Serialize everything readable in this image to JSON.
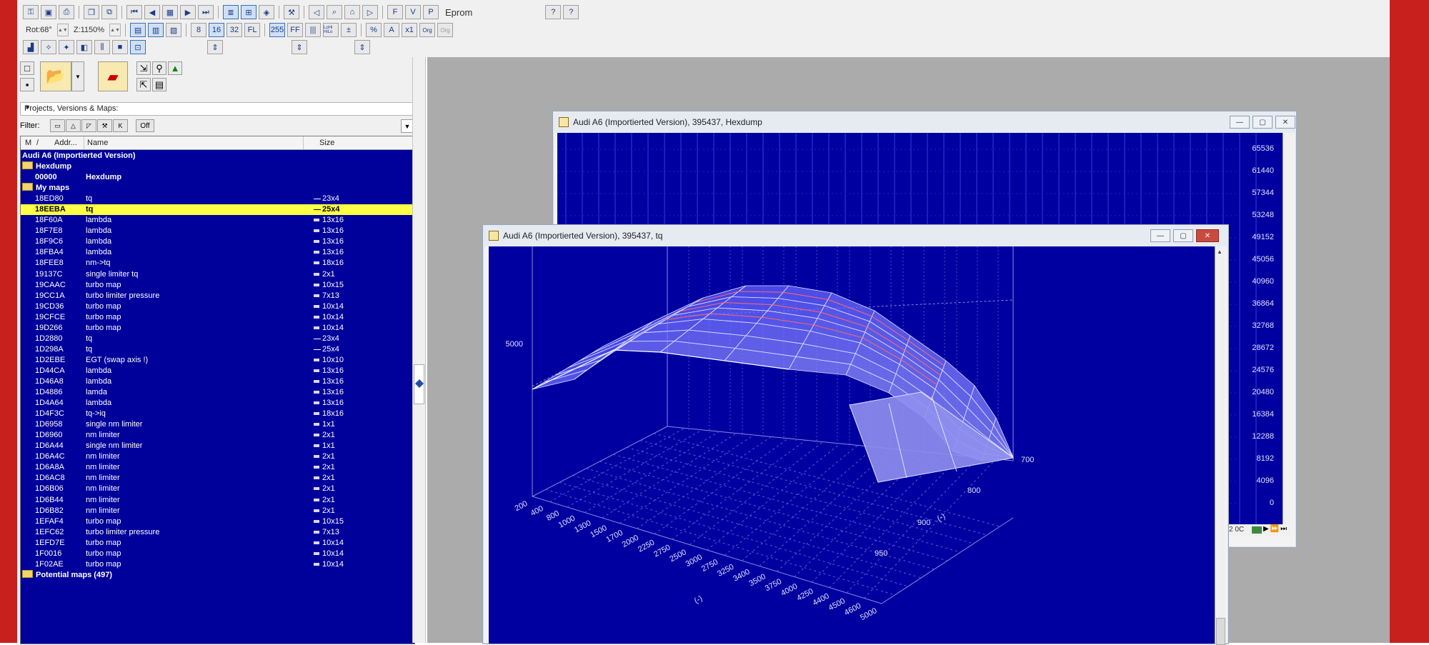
{
  "toolbar": {
    "rot_label": "Rot:68°",
    "zoom_label": "Z:1150%",
    "eprom_label": "Eprom",
    "row3_btns": [
      "8",
      "16",
      "32",
      "FL",
      "255",
      "FF",
      "|||",
      "LoHi HiLo",
      "%",
      "A",
      "x1",
      "Org",
      "Org"
    ]
  },
  "left": {
    "dropdown": "Projects, Versions & Maps:",
    "filter_label": "Filter:",
    "filter_off": "Off",
    "columns": [
      "M",
      "/",
      "Addr...",
      "Name",
      "Size"
    ],
    "rows": [
      {
        "type": "group",
        "label": "Audi A6 (Importierted Version)"
      },
      {
        "type": "folder",
        "label": "Hexdump"
      },
      {
        "type": "bold",
        "addr": "00000",
        "name": "Hexdump",
        "size": ""
      },
      {
        "type": "folder",
        "label": "My maps"
      },
      {
        "addr": "18ED80",
        "name": "tq",
        "size": "23x4",
        "sw": "line"
      },
      {
        "addr": "18EEBA",
        "name": "tq",
        "size": "25x4",
        "sw": "line",
        "sel": true
      },
      {
        "addr": "18F60A",
        "name": "lambda",
        "size": "13x16"
      },
      {
        "addr": "18F7E8",
        "name": "lambda",
        "size": "13x16"
      },
      {
        "addr": "18F9C6",
        "name": "lambda",
        "size": "13x16"
      },
      {
        "addr": "18FBA4",
        "name": "lambda",
        "size": "13x16"
      },
      {
        "addr": "18FEE8",
        "name": "nm->tq",
        "size": "18x16"
      },
      {
        "addr": "19137C",
        "name": "single limiter tq",
        "size": "2x1"
      },
      {
        "addr": "19CAAC",
        "name": "turbo map",
        "size": "10x15"
      },
      {
        "addr": "19CC1A",
        "name": "turbo limiter pressure",
        "size": "7x13"
      },
      {
        "addr": "19CD36",
        "name": "turbo map",
        "size": "10x14"
      },
      {
        "addr": "19CFCE",
        "name": "turbo map",
        "size": "10x14"
      },
      {
        "addr": "19D266",
        "name": "turbo map",
        "size": "10x14"
      },
      {
        "addr": "1D2880",
        "name": "tq",
        "size": "23x4",
        "sw": "line"
      },
      {
        "addr": "1D298A",
        "name": "tq",
        "size": "25x4",
        "sw": "line"
      },
      {
        "addr": "1D2EBE",
        "name": "EGT (swap axis !)",
        "size": "10x10"
      },
      {
        "addr": "1D44CA",
        "name": "lambda",
        "size": "13x16"
      },
      {
        "addr": "1D46A8",
        "name": "lambda",
        "size": "13x16"
      },
      {
        "addr": "1D4886",
        "name": "lamda",
        "size": "13x16"
      },
      {
        "addr": "1D4A64",
        "name": "lambda",
        "size": "13x16"
      },
      {
        "addr": "1D4F3C",
        "name": "tq->iq",
        "size": "18x16"
      },
      {
        "addr": "1D6958",
        "name": "single nm limiter",
        "size": "1x1"
      },
      {
        "addr": "1D6960",
        "name": "nm limiter",
        "size": "2x1"
      },
      {
        "addr": "1D6A44",
        "name": "single nm limiter",
        "size": "1x1"
      },
      {
        "addr": "1D6A4C",
        "name": "nm limiter",
        "size": "2x1"
      },
      {
        "addr": "1D6A8A",
        "name": "nm limiter",
        "size": "2x1"
      },
      {
        "addr": "1D6AC8",
        "name": "nm limiter",
        "size": "2x1"
      },
      {
        "addr": "1D6B06",
        "name": "nm limiter",
        "size": "2x1"
      },
      {
        "addr": "1D6B44",
        "name": "nm limiter",
        "size": "2x1"
      },
      {
        "addr": "1D6B82",
        "name": "nm limiter",
        "size": "2x1"
      },
      {
        "addr": "1EFAF4",
        "name": "turbo map",
        "size": "10x15"
      },
      {
        "addr": "1EFC62",
        "name": "turbo limiter pressure",
        "size": "7x13"
      },
      {
        "addr": "1EFD7E",
        "name": "turbo map",
        "size": "10x14"
      },
      {
        "addr": "1F0016",
        "name": "turbo map",
        "size": "10x14"
      },
      {
        "addr": "1F02AE",
        "name": "turbo map",
        "size": "10x14"
      },
      {
        "type": "folder",
        "label": "Potential maps (497)"
      }
    ]
  },
  "hexdump_window": {
    "title": "Audi A6 (Importierted Version), 395437, Hexdump",
    "y_labels": [
      "65536",
      "61440",
      "57344",
      "53248",
      "49152",
      "45056",
      "40960",
      "36864",
      "32768",
      "28672",
      "24576",
      "20480",
      "16384",
      "12288",
      "8192",
      "4096",
      "0"
    ],
    "x_partial": "2  0C"
  },
  "map_window": {
    "title": "Audi A6 (Importierted Version), 395437, tq",
    "z_tick": "5000",
    "x_ticks": [
      "200",
      "400",
      "800",
      "1000",
      "1300",
      "1500",
      "1700",
      "2000",
      "2250",
      "2750",
      "2500",
      "3000",
      "2750",
      "3250",
      "3400",
      "3500",
      "3750",
      "4000",
      "4250",
      "4400",
      "4500",
      "4600",
      "5000"
    ],
    "x_axis_label": "(-)",
    "y_ticks": [
      "700",
      "800",
      "900",
      "950"
    ],
    "y_axis_label": "(-)"
  },
  "colors": {
    "map_bg": "#0000a0",
    "selection": "#ffff44",
    "frame": "#c8201d"
  }
}
